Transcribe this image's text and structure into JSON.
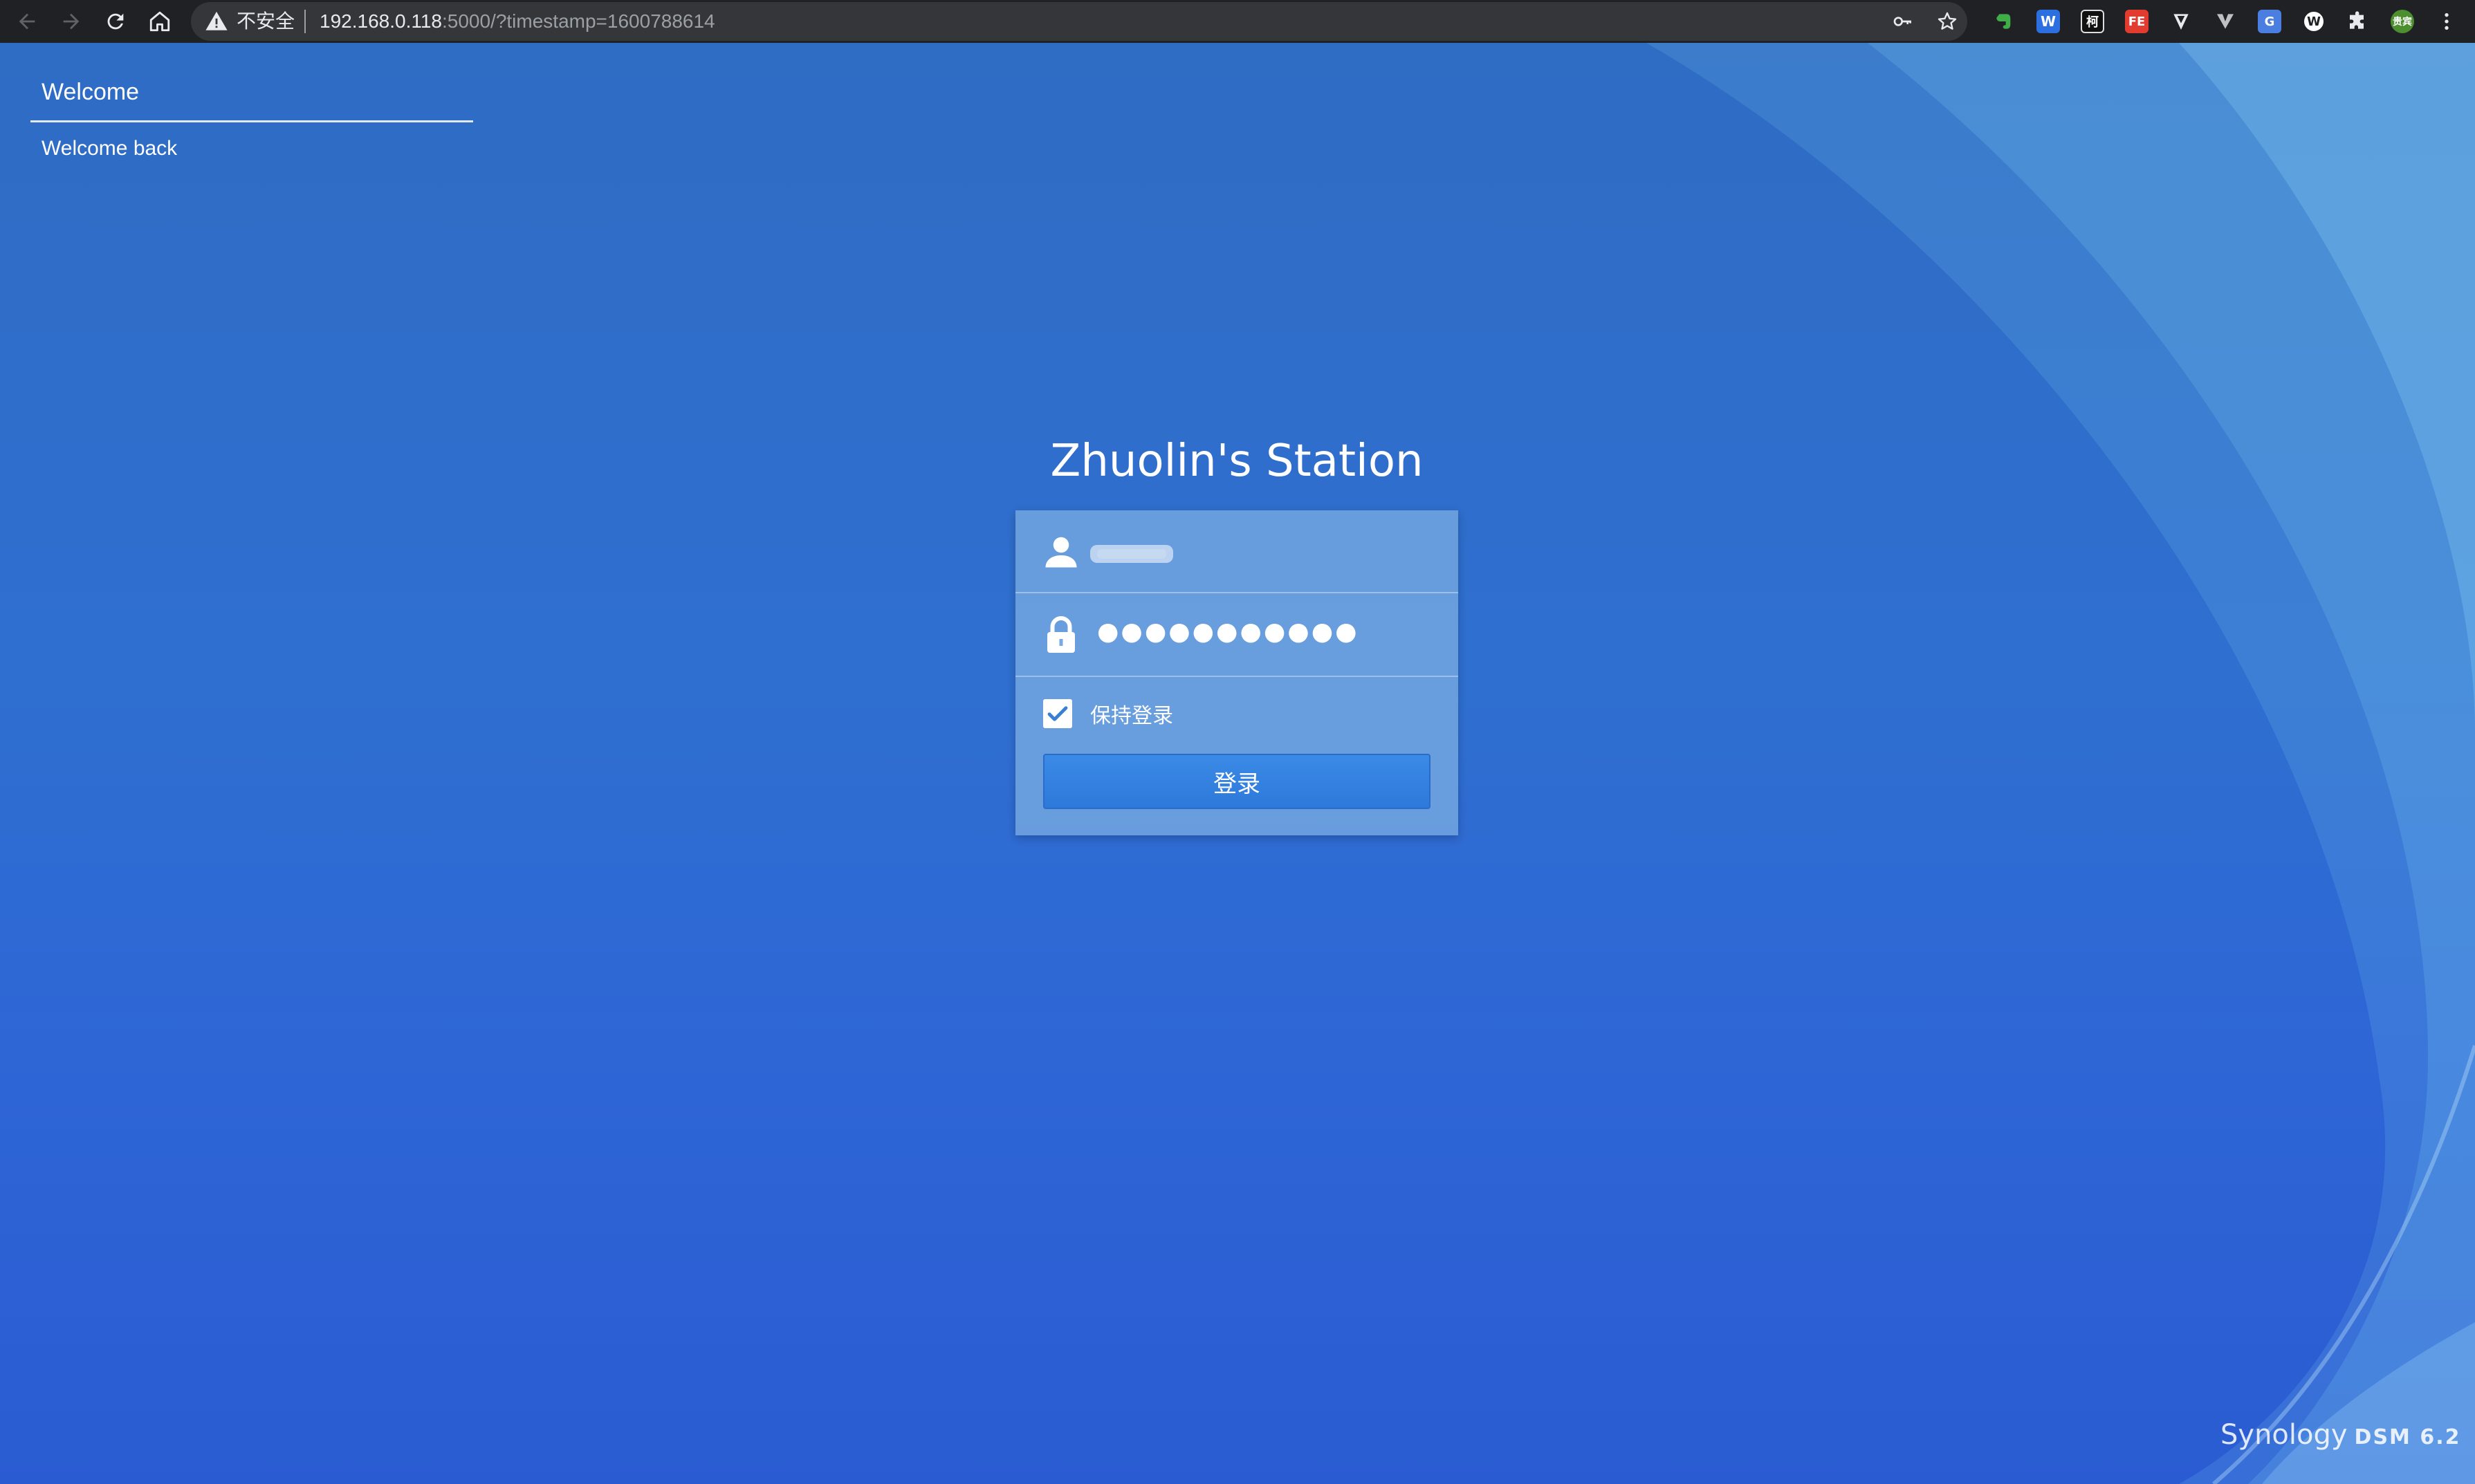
{
  "browser": {
    "insecure_label": "不安全",
    "url_host": "192.168.0.118",
    "url_rest": ":5000/?timestamp=1600788614",
    "icons": [
      "back-icon",
      "forward-icon",
      "reload-icon",
      "home-icon",
      "warning-icon",
      "key-icon",
      "star-icon",
      "evernote-icon",
      "w-icon",
      "ke-icon",
      "fe-icon",
      "vue-devtools-icon",
      "v-icon",
      "translate-icon",
      "w-circle-icon",
      "puzzle-icon",
      "profile-avatar",
      "kebab-menu-icon"
    ],
    "extensions": {
      "w": "W",
      "ke": "柯",
      "fe": "FE",
      "translate": "G",
      "w_circle": "W",
      "profile": "贵宾"
    }
  },
  "sidebar": {
    "title": "Welcome",
    "subtitle": "Welcome back"
  },
  "login": {
    "station_title": "Zhuolin's Station",
    "password_mask": "●●●●●●●●●●●",
    "remember_label": "保持登录",
    "remember_checked": true,
    "submit_label": "登录"
  },
  "brand": {
    "vendor": "Synology",
    "product": "DSM 6.2"
  },
  "colors": {
    "background": "#2f6ccc",
    "panel": "#78aae1",
    "button": "#3282e0",
    "chrome": "#202124"
  }
}
